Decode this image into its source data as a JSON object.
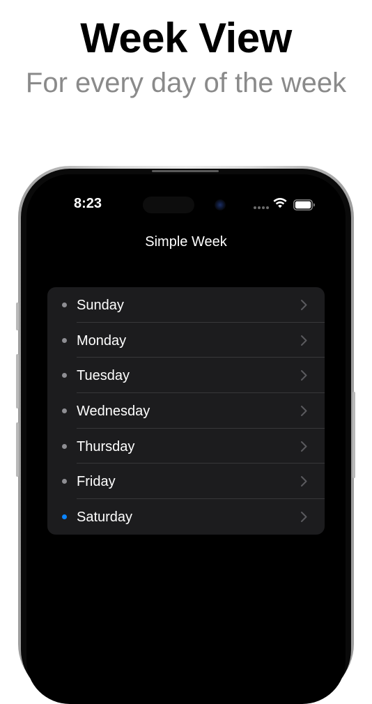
{
  "header": {
    "title": "Week View",
    "subtitle": "For every day of the week"
  },
  "status_bar": {
    "time": "8:23"
  },
  "nav": {
    "title": "Simple Week"
  },
  "days": [
    {
      "label": "Sunday",
      "bullet_color": "#8e8e93"
    },
    {
      "label": "Monday",
      "bullet_color": "#8e8e93"
    },
    {
      "label": "Tuesday",
      "bullet_color": "#8e8e93"
    },
    {
      "label": "Wednesday",
      "bullet_color": "#8e8e93"
    },
    {
      "label": "Thursday",
      "bullet_color": "#8e8e93"
    },
    {
      "label": "Friday",
      "bullet_color": "#8e8e93"
    },
    {
      "label": "Saturday",
      "bullet_color": "#0a84ff"
    }
  ],
  "icons": {
    "wifi": "wifi-icon",
    "battery": "battery-icon",
    "chevron": "chevron-right-icon",
    "bullet": "bullet-dot-icon"
  },
  "colors": {
    "accent": "#0a84ff",
    "list_background": "#1c1c1e",
    "screen_background": "#000000",
    "subtitle_gray": "#8a8a8a"
  }
}
